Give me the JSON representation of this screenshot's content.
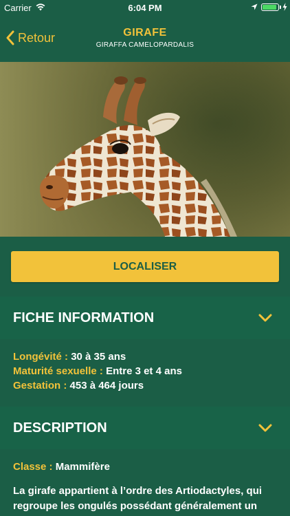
{
  "status_bar": {
    "carrier": "Carrier",
    "time": "6:04 PM",
    "battery_level": 0.9,
    "icons": [
      "wifi-icon",
      "location-arrow-icon",
      "battery-icon",
      "charging-bolt-icon"
    ]
  },
  "nav": {
    "back_label": "Retour",
    "back_icon": "chevron-left-icon",
    "title": "GIRAFE",
    "subtitle": "GIRAFFA CAMELOPARDALIS"
  },
  "colors": {
    "background": "#1b5e46",
    "section_header": "#186348",
    "accent": "#f2c23a",
    "text": "#ffffff"
  },
  "actions": {
    "localiser_label": "LOCALISER"
  },
  "fiche": {
    "title": "FICHE INFORMATION",
    "expand_icon": "chevron-down-icon",
    "rows": [
      {
        "label": "Longévité :",
        "value": "30 à 35 ans"
      },
      {
        "label": "Maturité sexuelle :",
        "value": "Entre 3 et 4 ans"
      },
      {
        "label": "Gestation :",
        "value": "453 à 464 jours"
      }
    ]
  },
  "description": {
    "title": "DESCRIPTION",
    "expand_icon": "chevron-down-icon",
    "classe_label": "Classe :",
    "classe_value": "Mammifère",
    "text_line_1": "La girafe appartient à l’ordre des Artiodactyles, qui",
    "text_line_2": "regroupe les ongulés possédant généralement un"
  }
}
